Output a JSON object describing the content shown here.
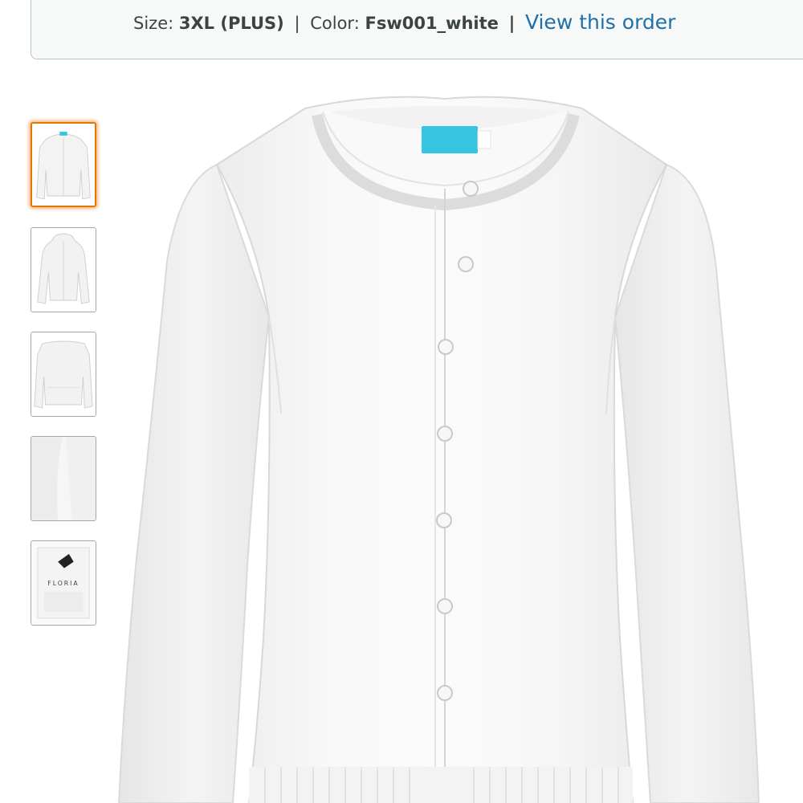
{
  "order": {
    "size_label": "Size:",
    "size_value": "3XL (PLUS)",
    "separator": "|",
    "color_label": "Color:",
    "color_value": "Fsw001_white",
    "link_text": "View this order"
  },
  "gallery": {
    "selected_index": 0,
    "thumbnails": [
      {
        "view": "front-flat"
      },
      {
        "view": "front-model"
      },
      {
        "view": "back"
      },
      {
        "view": "detail-closeup"
      },
      {
        "view": "packaging"
      }
    ],
    "packaging_brand_text": "FLORIA"
  },
  "colors": {
    "banner_bg": "#f7f8f8",
    "banner_border": "#b5c4cc",
    "link": "#1f6fa8",
    "selected_thumb_border": "#e77600",
    "tag_blue": "#36c5e0"
  }
}
